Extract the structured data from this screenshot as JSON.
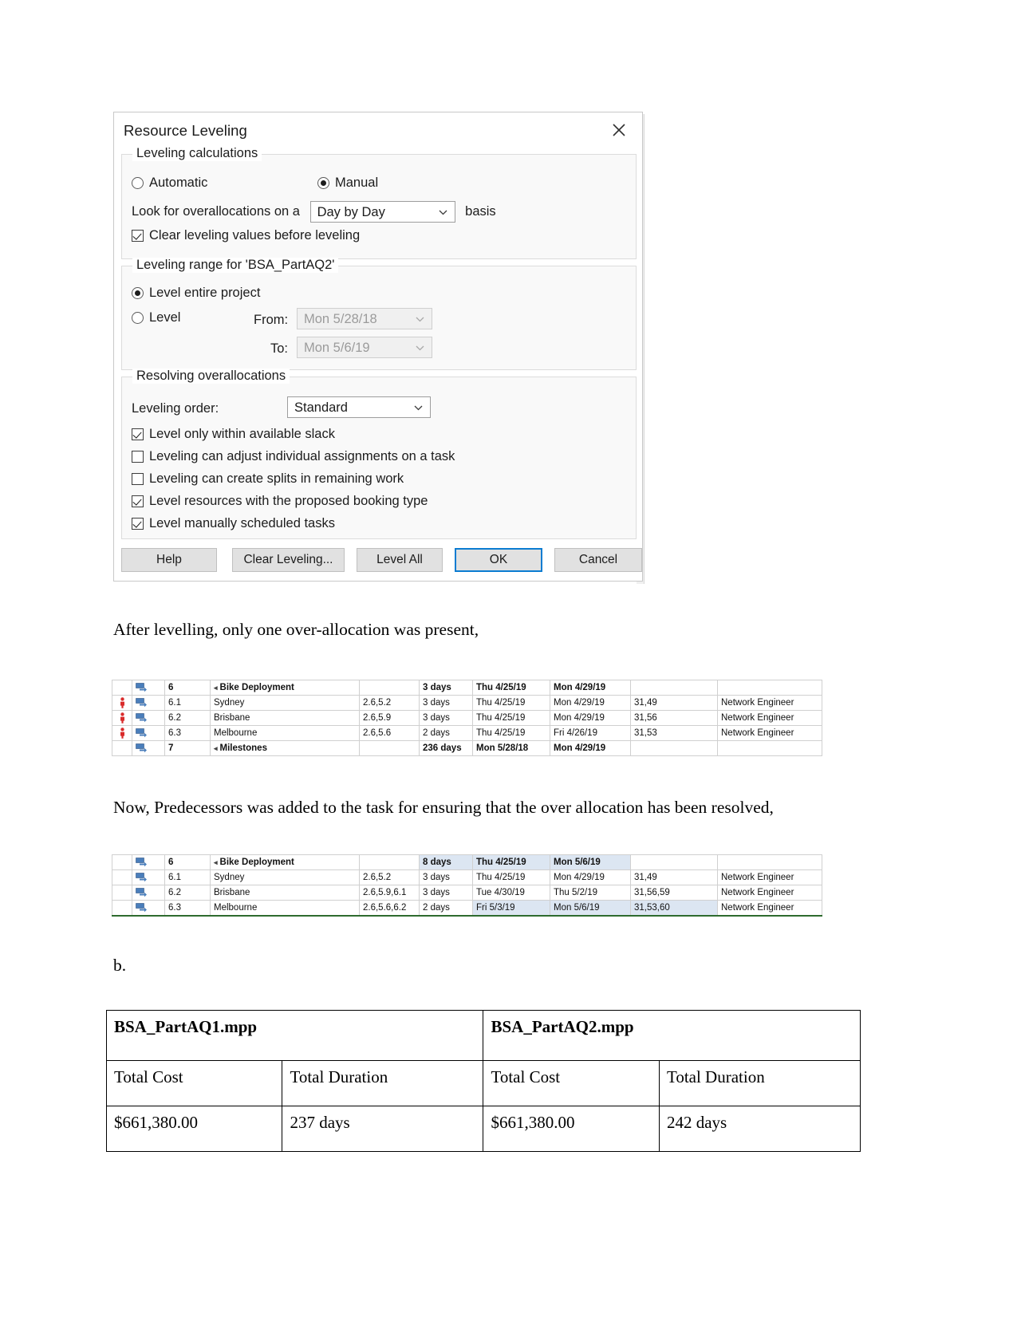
{
  "dialog": {
    "title": "Resource Leveling",
    "close_icon": "close-icon",
    "groups": {
      "calculations": {
        "legend": "Leveling calculations",
        "automatic_label": "Automatic",
        "automatic_selected": false,
        "manual_label": "Manual",
        "manual_selected": true,
        "lookfor_prefix": "Look for overallocations on a",
        "basis_value": "Day by Day",
        "lookfor_suffix": "basis",
        "clear_values_label": "Clear leveling values before leveling",
        "clear_values_checked": true
      },
      "range": {
        "legend": "Leveling range for 'BSA_PartAQ2'",
        "entire_label": "Level entire project",
        "entire_selected": true,
        "level_label": "Level",
        "level_selected": false,
        "from_label": "From:",
        "from_value": "Mon 5/28/18",
        "to_label": "To:",
        "to_value": "Mon 5/6/19"
      },
      "resolving": {
        "legend": "Resolving overallocations",
        "order_label": "Leveling order:",
        "order_value": "Standard",
        "options": [
          {
            "label": "Level only within available slack",
            "checked": true
          },
          {
            "label": "Leveling can adjust individual assignments on a task",
            "checked": false
          },
          {
            "label": "Leveling can create splits in remaining work",
            "checked": false
          },
          {
            "label": "Level resources with the proposed booking type",
            "checked": true
          },
          {
            "label": "Level manually scheduled tasks",
            "checked": true
          }
        ]
      }
    },
    "buttons": {
      "help": "Help",
      "clear_leveling": "Clear Leveling...",
      "level_all": "Level All",
      "ok": "OK",
      "cancel": "Cancel"
    },
    "accent_color": "#0a7cd1"
  },
  "paragraphs": {
    "after_levelling": "After levelling, only one over-allocation was present,",
    "predecessors": "Now, Predecessors was added to the task for ensuring that the over allocation has been resolved,",
    "section_b": "b."
  },
  "table_before": {
    "rows": [
      {
        "indicator": "",
        "mode": "auto-schedule-icon",
        "wbs": "6",
        "name": "Bike Deployment",
        "summary": true,
        "predecessors": "",
        "duration": "3 days",
        "start": "Thu 4/25/19",
        "finish": "Mon 4/29/19",
        "ids": "",
        "resource": ""
      },
      {
        "indicator": "overallocated-icon",
        "mode": "auto-schedule-icon",
        "wbs": "6.1",
        "name": "Sydney",
        "summary": false,
        "predecessors": "2.6,5.2",
        "duration": "3 days",
        "start": "Thu 4/25/19",
        "finish": "Mon 4/29/19",
        "ids": "31,49",
        "resource": "Network Engineer"
      },
      {
        "indicator": "overallocated-icon",
        "mode": "auto-schedule-icon",
        "wbs": "6.2",
        "name": "Brisbane",
        "summary": false,
        "predecessors": "2.6,5.9",
        "duration": "3 days",
        "start": "Thu 4/25/19",
        "finish": "Mon 4/29/19",
        "ids": "31,56",
        "resource": "Network Engineer"
      },
      {
        "indicator": "overallocated-icon",
        "mode": "auto-schedule-icon",
        "wbs": "6.3",
        "name": "Melbourne",
        "summary": false,
        "predecessors": "2.6,5.6",
        "duration": "2 days",
        "start": "Thu 4/25/19",
        "finish": "Fri 4/26/19",
        "ids": "31,53",
        "resource": "Network Engineer"
      },
      {
        "indicator": "",
        "mode": "auto-schedule-icon",
        "wbs": "7",
        "name": "Milestones",
        "summary": true,
        "predecessors": "",
        "duration": "236 days",
        "start": "Mon 5/28/18",
        "finish": "Mon 4/29/19",
        "ids": "",
        "resource": ""
      }
    ]
  },
  "table_after": {
    "rows": [
      {
        "indicator": "",
        "mode": "auto-schedule-icon",
        "wbs": "6",
        "name": "Bike Deployment",
        "summary": true,
        "predecessors": "",
        "duration": "8 days",
        "start": "Thu 4/25/19",
        "finish": "Mon 5/6/19",
        "ids": "",
        "resource": ""
      },
      {
        "indicator": "",
        "mode": "auto-schedule-icon",
        "wbs": "6.1",
        "name": "Sydney",
        "summary": false,
        "predecessors": "2.6,5.2",
        "duration": "3 days",
        "start": "Thu 4/25/19",
        "finish": "Mon 4/29/19",
        "ids": "31,49",
        "resource": "Network Engineer"
      },
      {
        "indicator": "",
        "mode": "auto-schedule-icon",
        "wbs": "6.2",
        "name": "Brisbane",
        "summary": false,
        "predecessors": "2.6,5.9,6.1",
        "duration": "3 days",
        "start": "Tue 4/30/19",
        "finish": "Thu 5/2/19",
        "ids": "31,56,59",
        "resource": "Network Engineer"
      },
      {
        "indicator": "",
        "mode": "auto-schedule-icon",
        "wbs": "6.3",
        "name": "Melbourne",
        "summary": false,
        "predecessors": "2.6,5.6,6.2",
        "duration": "2 days",
        "start": "Fri 5/3/19",
        "finish": "Mon 5/6/19",
        "ids": "31,53,60",
        "resource": "Network Engineer"
      }
    ]
  },
  "comparison": {
    "file1": "BSA_PartAQ1.mpp",
    "file2": "BSA_PartAQ2.mpp",
    "labels": {
      "cost": "Total Cost",
      "duration": "Total Duration"
    },
    "values": {
      "file1_cost": "$661,380.00",
      "file1_duration": "237 days",
      "file2_cost": "$661,380.00",
      "file2_duration": "242 days"
    }
  }
}
